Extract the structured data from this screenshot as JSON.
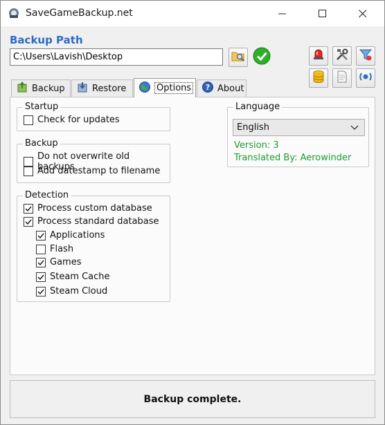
{
  "window": {
    "title": "SaveGameBackup.net"
  },
  "backup_path": {
    "heading": "Backup Path",
    "value": "C:\\Users\\Lavish\\Desktop"
  },
  "toolbar": {
    "icons": [
      "browse-folder-icon",
      "confirm-check-icon",
      "alarm-icon",
      "tools-icon",
      "filter-icon",
      "database-icon",
      "document-icon",
      "sync-icon"
    ]
  },
  "tabs": [
    {
      "label": "Backup",
      "icon": "backup-icon"
    },
    {
      "label": "Restore",
      "icon": "restore-icon"
    },
    {
      "label": "Options",
      "icon": "globe-icon",
      "active": true
    },
    {
      "label": "About",
      "icon": "help-icon"
    }
  ],
  "options": {
    "startup": {
      "label": "Startup",
      "check_updates": {
        "label": "Check for updates",
        "checked": false
      }
    },
    "backup": {
      "label": "Backup",
      "no_overwrite": {
        "label": "Do not overwrite old backups",
        "checked": false
      },
      "datestamp": {
        "label": "Add datestamp to filename",
        "checked": false
      }
    },
    "detection": {
      "label": "Detection",
      "items": [
        {
          "label": "Process custom database",
          "checked": true
        },
        {
          "label": "Process standard database",
          "checked": true
        },
        {
          "label": "Applications",
          "checked": true
        },
        {
          "label": "Flash",
          "checked": false
        },
        {
          "label": "Games",
          "checked": true
        },
        {
          "label": "Steam Cache",
          "checked": true
        },
        {
          "label": "Steam Cloud",
          "checked": true
        }
      ]
    },
    "language": {
      "label": "Language",
      "selected": "English",
      "version": "Version: 3",
      "translated_by": "Translated By: Aerowinder"
    }
  },
  "status": {
    "text": "Backup complete."
  },
  "colors": {
    "accent": "#2c6bc4",
    "success": "#1d9a2e"
  }
}
